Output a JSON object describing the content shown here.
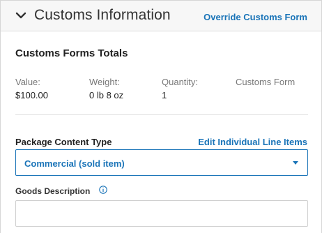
{
  "header": {
    "title": "Customs Information",
    "override_link": "Override Customs Form",
    "collapse_icon": "chevron-down-icon"
  },
  "totals": {
    "title": "Customs Forms Totals",
    "columns": [
      {
        "label": "Value:",
        "value": "$100.00"
      },
      {
        "label": "Weight:",
        "value": "0 lb 8 oz"
      },
      {
        "label": "Quantity:",
        "value": "1"
      },
      {
        "label": "Customs Form",
        "value": ""
      }
    ]
  },
  "package_content": {
    "label": "Package Content Type",
    "edit_link": "Edit Individual Line Items",
    "selected": "Commercial (sold item)"
  },
  "goods": {
    "label": "Goods Description",
    "info_icon": "info-icon",
    "value": ""
  },
  "colors": {
    "accent": "#1a74b8",
    "header_bg": "#f7f7f7",
    "border": "#d6d6d6"
  }
}
